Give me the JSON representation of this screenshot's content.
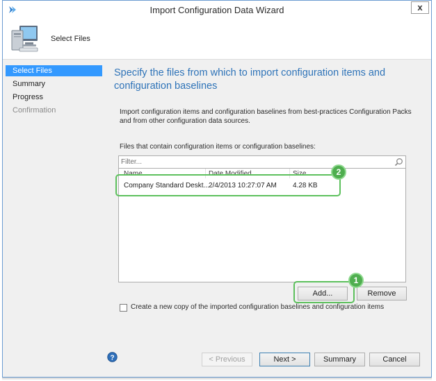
{
  "window": {
    "title": "Import Configuration Data Wizard",
    "close_label": "x"
  },
  "header": {
    "page_title": "Select Files"
  },
  "nav": {
    "items": [
      {
        "label": "Select Files",
        "state": "active"
      },
      {
        "label": "Summary",
        "state": "normal"
      },
      {
        "label": "Progress",
        "state": "normal"
      },
      {
        "label": "Confirmation",
        "state": "muted"
      }
    ]
  },
  "main": {
    "title": "Specify the files from which to import configuration items and configuration baselines",
    "description": "Import configuration items and configuration baselines from best-practices Configuration Packs and from other configuration data sources.",
    "files_label": "Files that contain configuration items or configuration baselines:",
    "filter_placeholder": "Filter...",
    "columns": [
      "Name",
      "Date Modified",
      "Size"
    ],
    "rows": [
      {
        "name": "Company Standard Deskt...",
        "date_modified": "2/4/2013 10:27:07 AM",
        "size": "4.28 KB"
      }
    ],
    "add_label": "Add...",
    "remove_label": "Remove",
    "copy_checkbox_label": "Create a new copy of the imported configuration baselines and configuration items",
    "copy_checkbox_checked": false
  },
  "footer": {
    "previous_label": "< Previous",
    "next_label": "Next >",
    "summary_label": "Summary",
    "cancel_label": "Cancel"
  },
  "callouts": [
    {
      "number": "1"
    },
    {
      "number": "2"
    }
  ],
  "colors": {
    "accent_title": "#2e73b8",
    "nav_active": "#3399ff",
    "callout_green": "#4fae4f"
  }
}
